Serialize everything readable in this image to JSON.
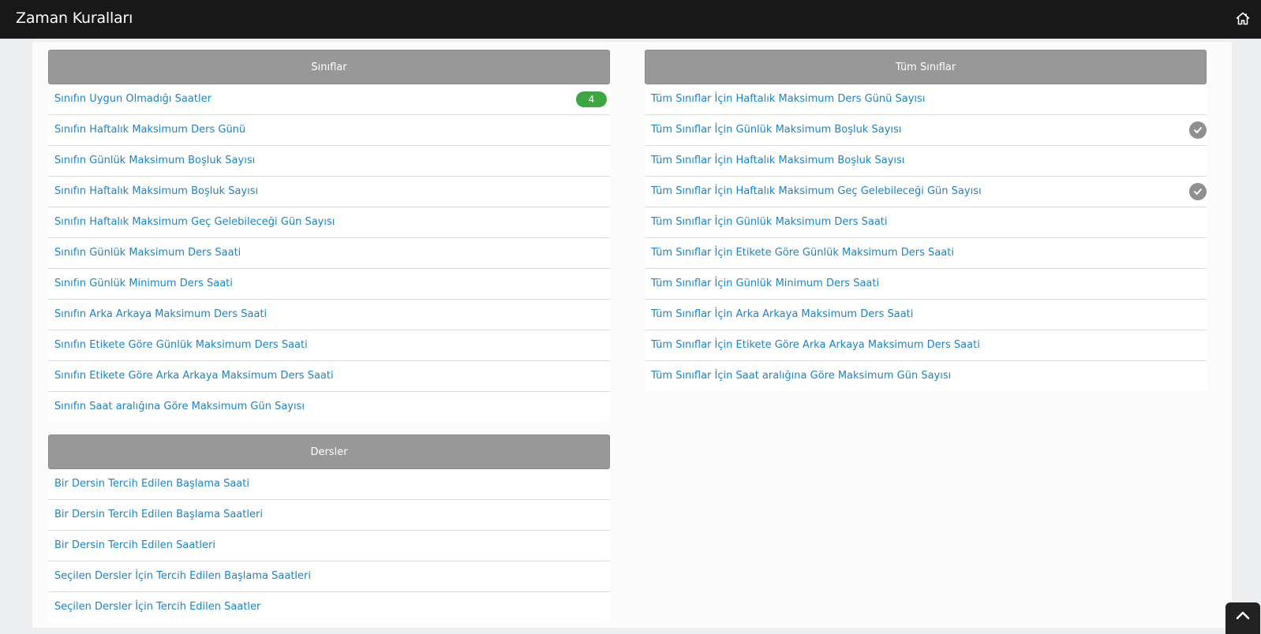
{
  "header": {
    "title": "Zaman Kuralları",
    "home_icon": "home-icon"
  },
  "colors": {
    "topbar": "#181818",
    "link": "#1c84c6",
    "panel_header": "#989898",
    "badge": "#3da541",
    "check": "#8f8f8f"
  },
  "siniflar": {
    "title": "Sınıflar",
    "items": [
      {
        "label": "Sınıfın Uygun Olmadığı Saatler",
        "badge": "4"
      },
      {
        "label": "Sınıfın Haftalık Maksimum Ders Günü"
      },
      {
        "label": "Sınıfın Günlük Maksimum Boşluk Sayısı"
      },
      {
        "label": "Sınıfın Haftalık Maksimum Boşluk Sayısı"
      },
      {
        "label": "Sınıfın Haftalık Maksimum Geç Gelebileceği Gün Sayısı"
      },
      {
        "label": "Sınıfın Günlük Maksimum Ders Saati"
      },
      {
        "label": "Sınıfın Günlük Minimum Ders Saati"
      },
      {
        "label": "Sınıfın Arka Arkaya Maksimum Ders Saati"
      },
      {
        "label": "Sınıfın Etikete Göre Günlük Maksimum Ders Saati"
      },
      {
        "label": "Sınıfın Etikete Göre Arka Arkaya Maksimum Ders Saati"
      },
      {
        "label": "Sınıfın Saat aralığına Göre Maksimum Gün Sayısı"
      }
    ]
  },
  "dersler": {
    "title": "Dersler",
    "items": [
      {
        "label": "Bir Dersin Tercih Edilen Başlama Saati"
      },
      {
        "label": "Bir Dersin Tercih Edilen Başlama Saatleri"
      },
      {
        "label": "Bir Dersin Tercih Edilen Saatleri"
      },
      {
        "label": "Seçilen Dersler İçin Tercih Edilen Başlama Saatleri"
      },
      {
        "label": "Seçilen Dersler İçin Tercih Edilen Saatler"
      }
    ]
  },
  "tum_siniflar": {
    "title": "Tüm Sınıflar",
    "items": [
      {
        "label": "Tüm Sınıflar İçin Haftalık Maksimum Ders Günü Sayısı"
      },
      {
        "label": "Tüm Sınıflar İçin Günlük Maksimum Boşluk Sayısı",
        "checked": true
      },
      {
        "label": "Tüm Sınıflar İçin Haftalık Maksimum Boşluk Sayısı"
      },
      {
        "label": "Tüm Sınıflar İçin Haftalık Maksimum Geç Gelebileceği Gün Sayısı",
        "checked": true
      },
      {
        "label": "Tüm Sınıflar İçin Günlük Maksimum Ders Saati"
      },
      {
        "label": "Tüm Sınıflar İçin Etikete Göre Günlük Maksimum Ders Saati"
      },
      {
        "label": "Tüm Sınıflar İçin Günlük Minimum Ders Saati"
      },
      {
        "label": "Tüm Sınıflar İçin Arka Arkaya Maksimum Ders Saati"
      },
      {
        "label": "Tüm Sınıflar İçin Etikete Göre Arka Arkaya Maksimum Ders Saati"
      },
      {
        "label": "Tüm Sınıflar İçin Saat aralığına Göre Maksimum Gün Sayısı"
      }
    ]
  }
}
